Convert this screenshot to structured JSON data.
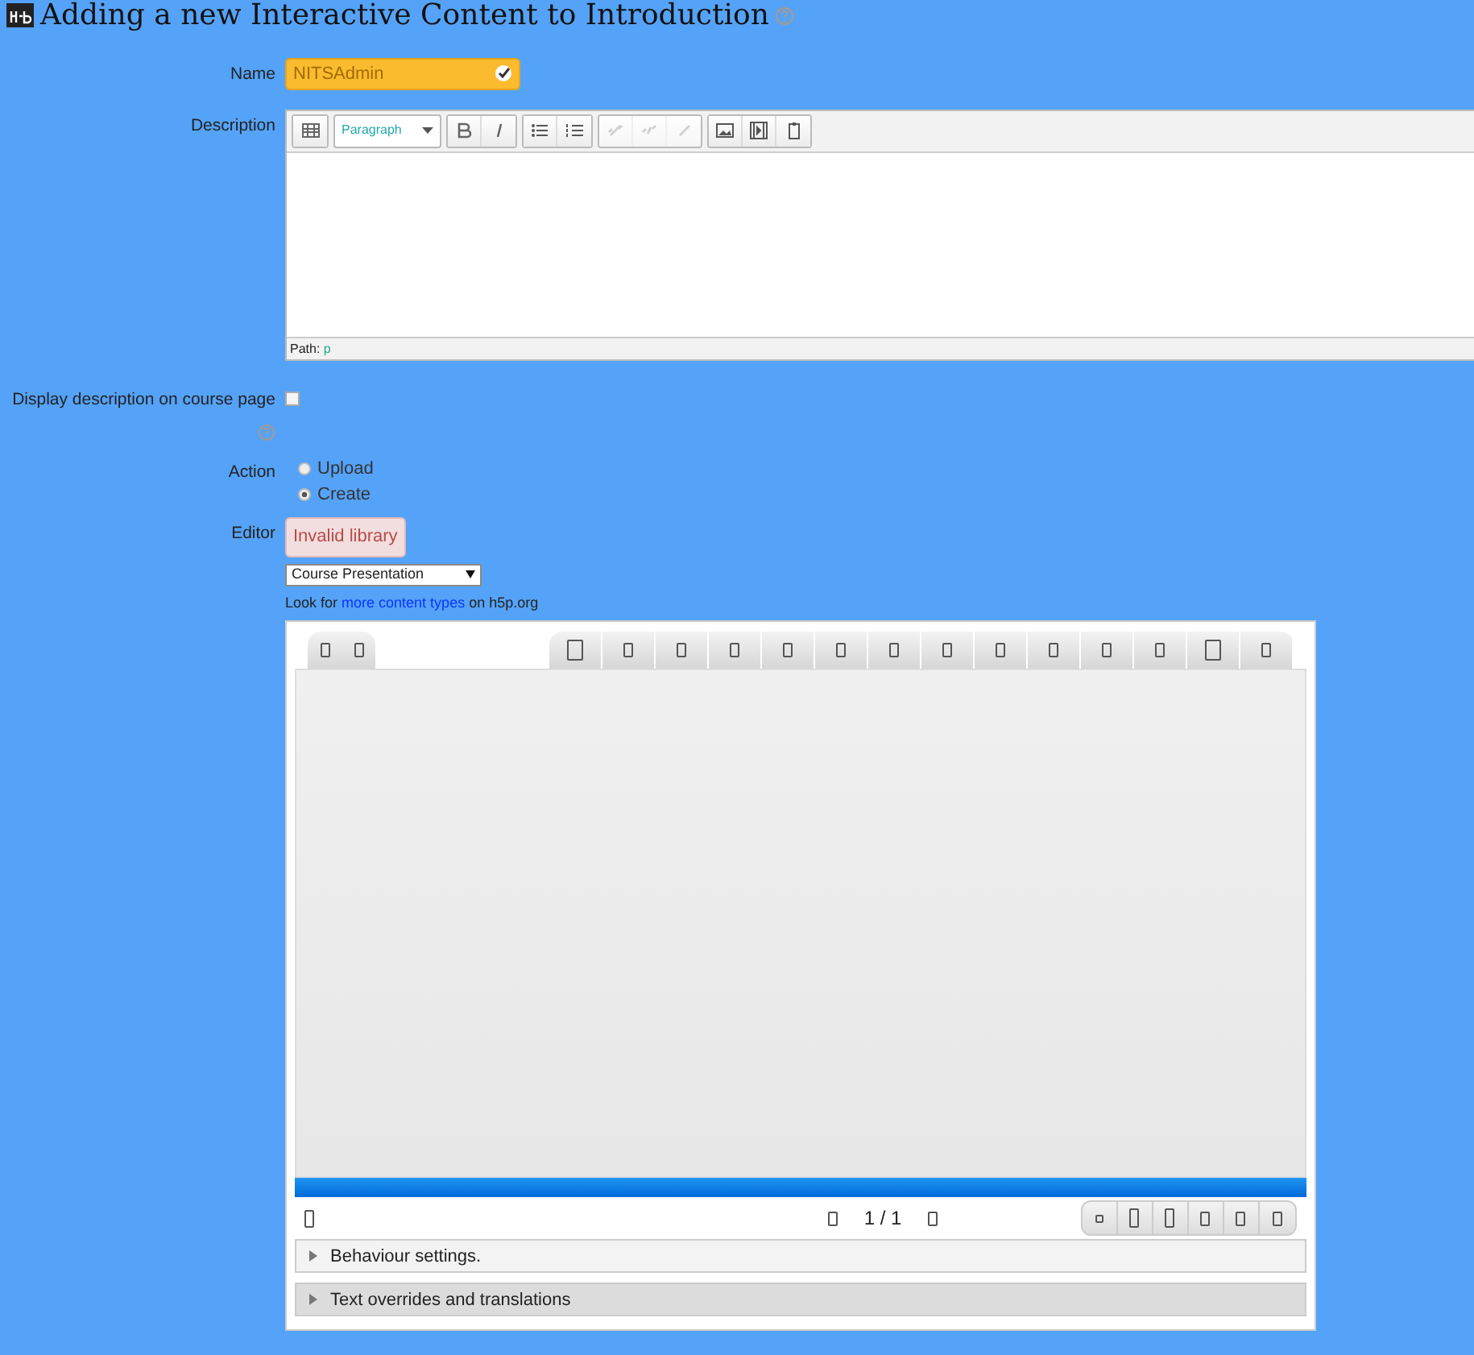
{
  "title": "Adding a new Interactive Content to Introduction",
  "name_field": {
    "label": "Name",
    "value": "NITSAdmin",
    "valid": true
  },
  "description": {
    "label": "Description",
    "format": "Paragraph",
    "toolbar": [
      [
        {
          "kind": "toggle",
          "disabled": false
        }
      ],
      [
        {
          "kind": "bold",
          "disabled": false
        },
        {
          "kind": "italic",
          "disabled": false
        }
      ],
      [
        {
          "kind": "bullets",
          "disabled": false
        },
        {
          "kind": "numbers",
          "disabled": false
        }
      ],
      [
        {
          "kind": "link",
          "disabled": true
        },
        {
          "kind": "unlink",
          "disabled": true
        },
        {
          "kind": "anchor",
          "disabled": true
        }
      ],
      [
        {
          "kind": "image",
          "disabled": false
        },
        {
          "kind": "media",
          "disabled": false
        },
        {
          "kind": "paste",
          "disabled": false
        }
      ]
    ],
    "path_label": "Path:",
    "path_value": "p"
  },
  "show_description": {
    "label": "Display description on course page",
    "checked": false
  },
  "action": {
    "label": "Action",
    "options": [
      {
        "label": "Upload",
        "selected": false
      },
      {
        "label": "Create",
        "selected": true
      }
    ]
  },
  "editor": {
    "label": "Editor",
    "error": "Invalid library",
    "library": "Course Presentation",
    "help_before": "Look for",
    "help_link": "more content types",
    "help_after": "on h5p.org",
    "progress": {
      "level": 1
    },
    "page": "1 / 1",
    "sections": [
      {
        "label": "Behaviour settings.",
        "expanded": false
      },
      {
        "label": "Text overrides and translations",
        "expanded": false
      }
    ]
  }
}
